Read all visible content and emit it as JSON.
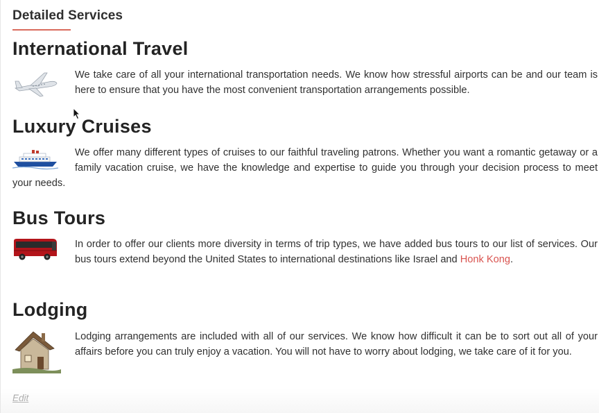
{
  "page_title": "Detailed Services",
  "services": [
    {
      "heading": "International Travel",
      "icon": "airplane-icon",
      "text": "We take care of all your international transportation needs.  We know how stressful airports can be and our team is here to ensure that you have the most convenient transportation arrangements possible."
    },
    {
      "heading": "Luxury Cruises",
      "icon": "cruise-ship-icon",
      "text": "We offer many different types of cruises to our faithful traveling patrons.  Whether you want a romantic getaway or a family vacation cruise, we have the knowledge and expertise to guide you through your decision process to meet your needs."
    },
    {
      "heading": "Bus Tours",
      "icon": "bus-icon",
      "text_before_link": "In order to offer our clients more diversity in terms of trip types, we have added bus tours to our list of services.  Our bus tours extend beyond the United States to international destinations like Israel and ",
      "link_text": "Honk Kong",
      "text_after_link": "."
    },
    {
      "heading": "Lodging",
      "icon": "cottage-icon",
      "text": "Lodging arrangements are included with all of our services.  We know how difficult it can be to sort out all of your affairs before you can truly enjoy a vacation.  You will not have to worry about lodging, we take care of it for you."
    }
  ],
  "edit_label": "Edit",
  "colors": {
    "accent": "#d96a5c",
    "link": "#d9534f",
    "text": "#303030",
    "heading": "#232323"
  }
}
